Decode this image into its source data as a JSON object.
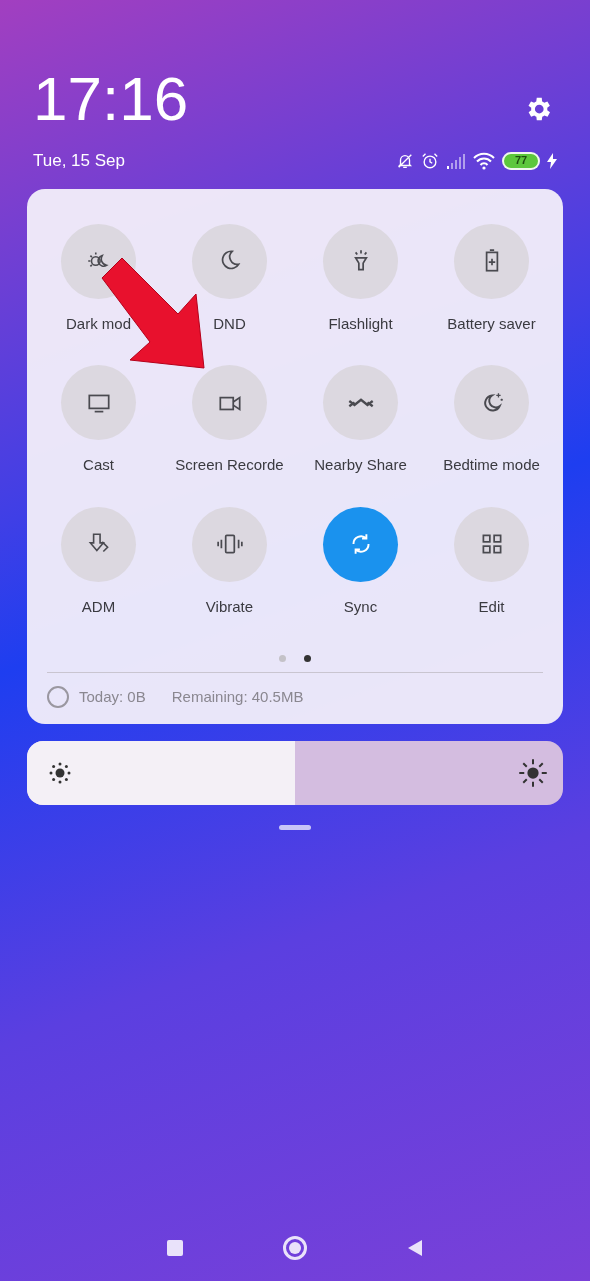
{
  "header": {
    "time": "17:16",
    "date": "Tue, 15 Sep",
    "battery_percent": "77"
  },
  "tiles": [
    {
      "label": "Dark mod",
      "on": false
    },
    {
      "label": "DND",
      "on": false
    },
    {
      "label": "Flashlight",
      "on": false
    },
    {
      "label": "Battery saver",
      "on": false
    },
    {
      "label": "Cast",
      "on": false
    },
    {
      "label": "Screen Recorde",
      "on": false
    },
    {
      "label": "Nearby Share",
      "on": false
    },
    {
      "label": "Bedtime mode",
      "on": false
    },
    {
      "label": "ADM",
      "on": false
    },
    {
      "label": "Vibrate",
      "on": false
    },
    {
      "label": "Sync",
      "on": true
    },
    {
      "label": "Edit",
      "on": false
    }
  ],
  "pages": [
    {
      "selected": false
    },
    {
      "selected": true
    }
  ],
  "data_usage": {
    "today": "Today: 0B",
    "remaining": "Remaining: 40.5MB"
  },
  "brightness": {
    "level": 0.5
  }
}
